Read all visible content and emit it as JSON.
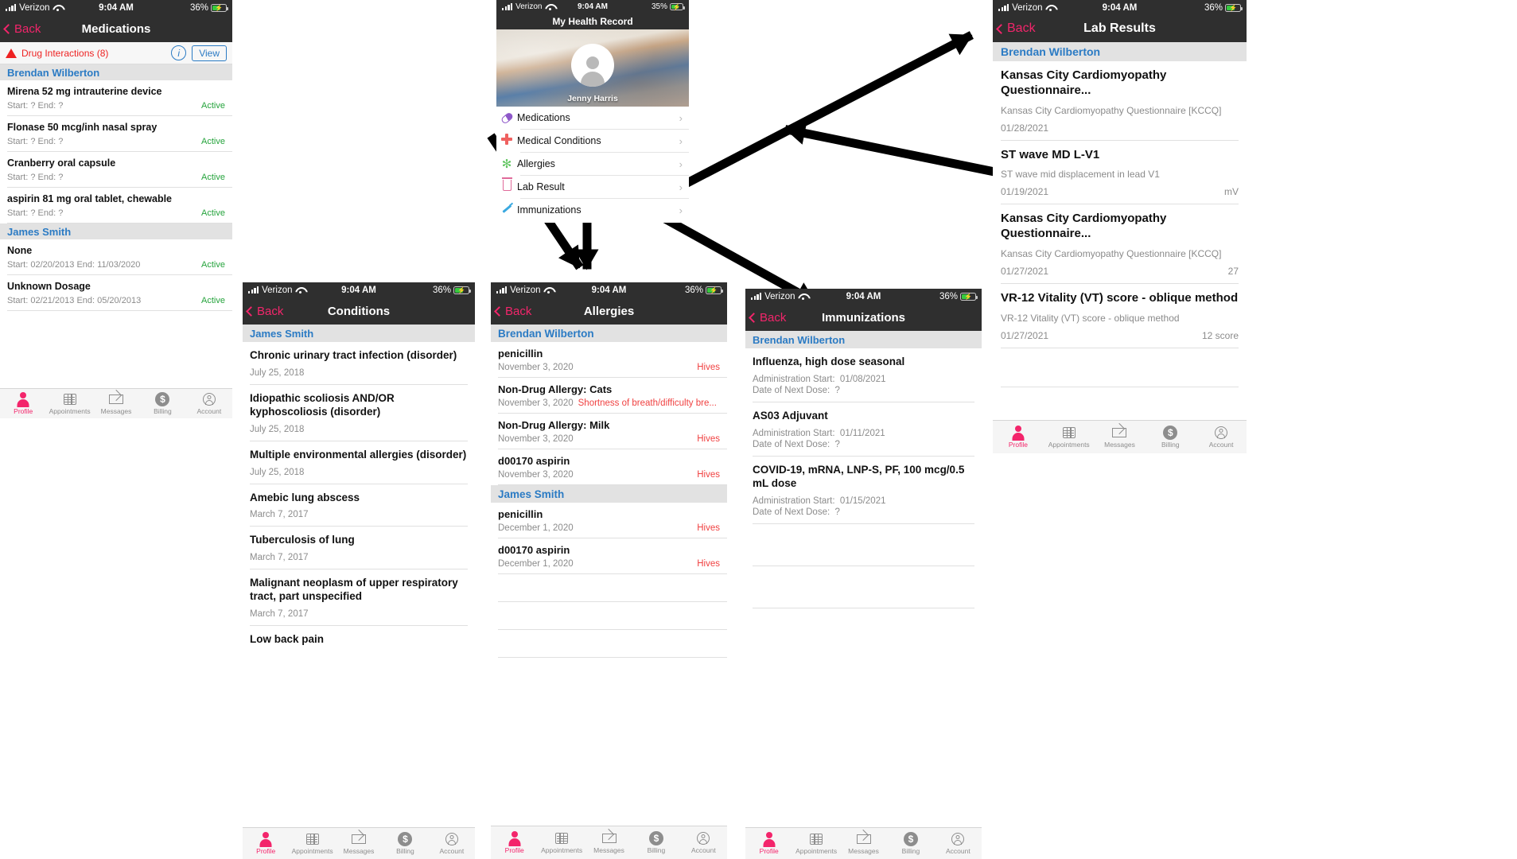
{
  "status": {
    "carrier": "Verizon",
    "time": "9:04 AM",
    "battery_36": "36%",
    "battery_35": "35%"
  },
  "panels": {
    "medications": {
      "nav": {
        "back": "Back",
        "title": "Medications"
      },
      "alert": {
        "label": "Drug Interactions (8)",
        "info": "i",
        "view": "View"
      },
      "groups": [
        {
          "patient": "Brendan Wilberton",
          "items": [
            {
              "title": "Mirena 52 mg intrauterine device",
              "sub": "Start: ?  End: ?",
              "status": "Active"
            },
            {
              "title": "Flonase 50 mcg/inh nasal spray",
              "sub": "Start: ?  End: ?",
              "status": "Active"
            },
            {
              "title": "Cranberry oral capsule",
              "sub": "Start: ?  End: ?",
              "status": "Active"
            },
            {
              "title": "aspirin 81 mg oral tablet, chewable",
              "sub": "Start: ?  End: ?",
              "status": "Active"
            }
          ]
        },
        {
          "patient": "James Smith",
          "items": [
            {
              "title": "None",
              "sub": "Start: 02/20/2013  End: 11/03/2020",
              "status": "Active"
            },
            {
              "title": "Unknown Dosage",
              "sub": "Start: 02/21/2013  End: 05/20/2013",
              "status": "Active"
            }
          ]
        }
      ]
    },
    "health_record": {
      "nav": {
        "title": "My Health Record"
      },
      "profile_name": "Jenny Harris",
      "menu": [
        {
          "icon": "pill-icon",
          "glyph": "ὈA",
          "label": "Medications",
          "chevron": "›"
        },
        {
          "icon": "medical-cross-icon",
          "glyph": "✚",
          "label": "Medical Conditions",
          "chevron": "›"
        },
        {
          "icon": "allergy-burst-icon",
          "glyph": "✳",
          "label": "Allergies",
          "chevron": "›"
        },
        {
          "icon": "lab-flask-icon",
          "glyph": "⚗",
          "label": "Lab Result",
          "chevron": "›"
        },
        {
          "icon": "syringe-icon",
          "glyph": "Ὀ9",
          "label": "Immunizations",
          "chevron": "›"
        }
      ]
    },
    "conditions": {
      "nav": {
        "back": "Back",
        "title": "Conditions"
      },
      "patient": "James Smith",
      "items": [
        {
          "title": "Chronic urinary tract infection (disorder)",
          "date": "July 25, 2018"
        },
        {
          "title": "Idiopathic scoliosis AND/OR kyphoscoliosis (disorder)",
          "date": "July 25, 2018"
        },
        {
          "title": "Multiple environmental allergies (disorder)",
          "date": "July 25, 2018"
        },
        {
          "title": "Amebic lung abscess",
          "date": "March 7, 2017"
        },
        {
          "title": "Tuberculosis of lung",
          "date": "March 7, 2017"
        },
        {
          "title": "Malignant neoplasm of upper respiratory tract, part unspecified",
          "date": "March 7, 2017"
        },
        {
          "title": "Low back pain",
          "date": ""
        }
      ]
    },
    "allergies": {
      "nav": {
        "back": "Back",
        "title": "Allergies"
      },
      "groups": [
        {
          "patient": "Brendan Wilberton",
          "items": [
            {
              "title": "penicillin",
              "date": "November 3, 2020",
              "reaction": "Hives",
              "reaction_inline": ""
            },
            {
              "title": "Non-Drug Allergy: Cats",
              "date": "November 3, 2020",
              "reaction": "",
              "reaction_inline": "Shortness of breath/difficulty bre..."
            },
            {
              "title": "Non-Drug Allergy: Milk",
              "date": "November 3, 2020",
              "reaction": "Hives",
              "reaction_inline": ""
            },
            {
              "title": "d00170 aspirin",
              "date": "November 3, 2020",
              "reaction": "Hives",
              "reaction_inline": ""
            }
          ]
        },
        {
          "patient": "James Smith",
          "items": [
            {
              "title": "penicillin",
              "date": "December 1, 2020",
              "reaction": "Hives",
              "reaction_inline": ""
            },
            {
              "title": "d00170 aspirin",
              "date": "December 1, 2020",
              "reaction": "Hives",
              "reaction_inline": ""
            }
          ]
        }
      ]
    },
    "immunizations": {
      "nav": {
        "back": "Back",
        "title": "Immunizations"
      },
      "patient": "Brendan Wilberton",
      "items": [
        {
          "title": "Influenza, high dose seasonal",
          "start_label": "Administration Start:",
          "start": "01/08/2021",
          "next_label": "Date of Next Dose:",
          "next": "?"
        },
        {
          "title": "AS03 Adjuvant",
          "start_label": "Administration Start:",
          "start": "01/11/2021",
          "next_label": "Date of Next Dose:",
          "next": "?"
        },
        {
          "title": "COVID-19, mRNA, LNP-S, PF, 100 mcg/0.5 mL dose",
          "start_label": "Administration Start:",
          "start": "01/15/2021",
          "next_label": "Date of Next Dose:",
          "next": "?"
        }
      ]
    },
    "lab_results": {
      "nav": {
        "back": "Back",
        "title": "Lab Results"
      },
      "patient": "Brendan Wilberton",
      "items": [
        {
          "title": "Kansas City Cardiomyopathy Questionnaire...",
          "sub": "Kansas City Cardiomyopathy Questionnaire [KCCQ]",
          "date": "01/28/2021",
          "value": ""
        },
        {
          "title": "ST wave MD L-V1",
          "sub": "ST wave mid displacement in lead V1",
          "date": "01/19/2021",
          "value": "mV"
        },
        {
          "title": "Kansas City Cardiomyopathy Questionnaire...",
          "sub": "Kansas City Cardiomyopathy Questionnaire [KCCQ]",
          "date": "01/27/2021",
          "value": "27"
        },
        {
          "title": "VR-12 Vitality (VT) score - oblique method",
          "sub": "VR-12 Vitality (VT) score - oblique method",
          "date": "01/27/2021",
          "value": "12 score"
        }
      ]
    }
  },
  "tabbar": {
    "items": [
      {
        "icon": "person-icon",
        "label": "Profile"
      },
      {
        "icon": "calendar-icon",
        "label": "Appointments"
      },
      {
        "icon": "envelope-icon",
        "label": "Messages"
      },
      {
        "icon": "dollar-icon",
        "label": "Billing"
      },
      {
        "icon": "account-icon",
        "label": "Account"
      }
    ]
  },
  "colors": {
    "accent": "#f3256b",
    "nav_bg": "#2f2f2f",
    "section_bg": "#e2e2e2",
    "patient_blue": "#2b7bc4",
    "active_green": "#25a33c",
    "alert_red": "#f04141"
  }
}
